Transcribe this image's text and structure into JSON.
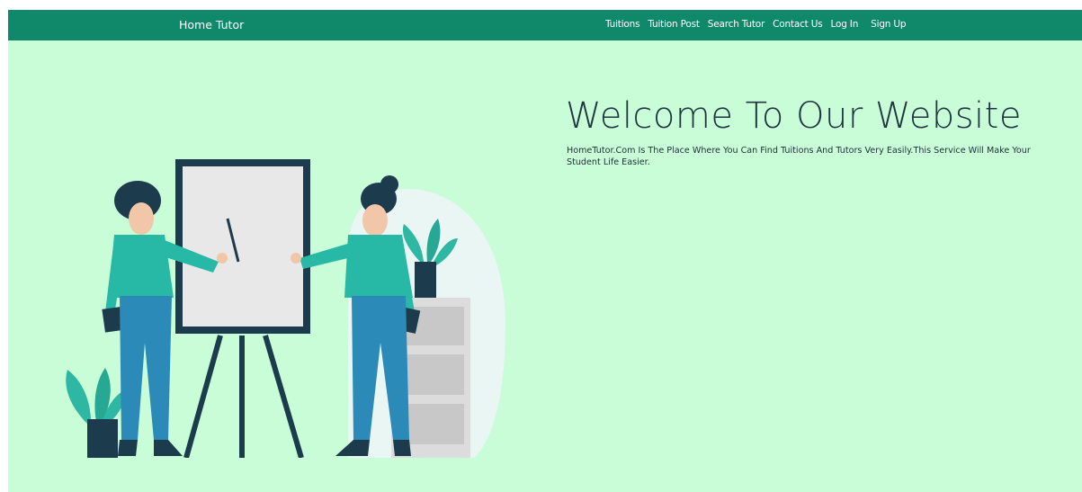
{
  "nav": {
    "brand": "Home Tutor",
    "links": [
      "Tuitions",
      "Tuition Post",
      "Search Tutor",
      "Contact Us",
      "Log In",
      "Sign Up"
    ]
  },
  "hero": {
    "title": "Welcome To Our Website",
    "description": "HomeTutor.Com Is The Place Where You Can Find Tuitions And Tutors Very Easily.This Service Will Make Your Student Life Easier."
  },
  "colors": {
    "navbar": "#10896b",
    "background": "#c9fdd7",
    "title": "#1f3340"
  },
  "illustration": {
    "icon": "teachers-whiteboard-illustration"
  }
}
